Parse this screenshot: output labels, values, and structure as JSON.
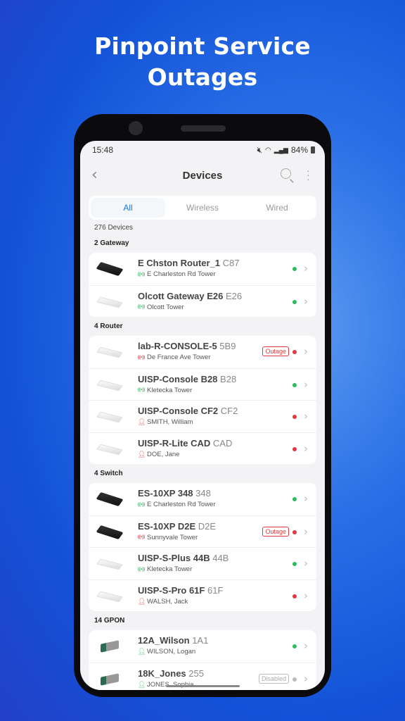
{
  "headline": [
    "Pinpoint Service",
    "Outages"
  ],
  "status": {
    "time": "15:48",
    "battery": "84%"
  },
  "header": {
    "back": "‹",
    "title": "Devices"
  },
  "tabs": [
    {
      "label": "All",
      "active": true
    },
    {
      "label": "Wireless"
    },
    {
      "label": "Wired"
    }
  ],
  "device_count": "276 Devices",
  "colors": {
    "online": "#2ebd59",
    "outage": "#e03a3e",
    "disabled": "#bbbbbb",
    "accent": "#1a73d9"
  },
  "sections": [
    {
      "title": "2 Gateway",
      "items": [
        {
          "name": "E Chston Router_1",
          "code": "C87",
          "sub": "E Charleston Rd Tower",
          "sub_icon": "tower-icon",
          "status": "online",
          "thumb": "dark"
        },
        {
          "name": "Olcott Gateway E26",
          "code": "E26",
          "sub": "Olcott Tower",
          "sub_icon": "tower-icon",
          "status": "online",
          "thumb": "white"
        }
      ]
    },
    {
      "title": "4 Router",
      "items": [
        {
          "name": "lab-R-CONSOLE-5",
          "code": "5B9",
          "sub": "De France Ave Tower",
          "sub_icon": "tower-icon",
          "status": "outage",
          "badge": "Outage",
          "thumb": "white"
        },
        {
          "name": "UISP-Console B28",
          "code": "B28",
          "sub": "Kletecka Tower",
          "sub_icon": "tower-icon",
          "status": "online",
          "thumb": "white"
        },
        {
          "name": "UISP-Console CF2",
          "code": "CF2",
          "sub": "SMITH, William",
          "sub_icon": "user-icon",
          "status": "outage",
          "thumb": "white"
        },
        {
          "name": "UISP-R-Lite CAD",
          "code": "CAD",
          "sub": "DOE, Jane",
          "sub_icon": "user-icon",
          "status": "outage",
          "thumb": "white"
        }
      ]
    },
    {
      "title": "4 Switch",
      "items": [
        {
          "name": "ES-10XP 348",
          "code": "348",
          "sub": "E Charleston Rd Tower",
          "sub_icon": "tower-icon",
          "status": "online",
          "thumb": "dark"
        },
        {
          "name": "ES-10XP D2E",
          "code": "D2E",
          "sub": "Sunnyvale Tower",
          "sub_icon": "tower-icon",
          "status": "outage",
          "badge": "Outage",
          "thumb": "dark"
        },
        {
          "name": "UISP-S-Plus 44B",
          "code": "44B",
          "sub": "Kletecka Tower",
          "sub_icon": "tower-icon",
          "status": "online",
          "thumb": "white"
        },
        {
          "name": "UISP-S-Pro 61F",
          "code": "61F",
          "sub": "WALSH, Jack",
          "sub_icon": "user-icon",
          "status": "outage",
          "thumb": "white"
        }
      ]
    },
    {
      "title": "14 GPON",
      "items": [
        {
          "name": "12A_Wilson",
          "code": "1A1",
          "sub": "WILSON, Logan",
          "sub_icon": "user-icon",
          "status": "online",
          "thumb": "sfp"
        },
        {
          "name": "18K_Jones",
          "code": "255",
          "sub": "JONES, Sophia",
          "sub_icon": "user-icon",
          "status": "disabled",
          "badge": "Disabled",
          "thumb": "sfp"
        }
      ]
    }
  ]
}
